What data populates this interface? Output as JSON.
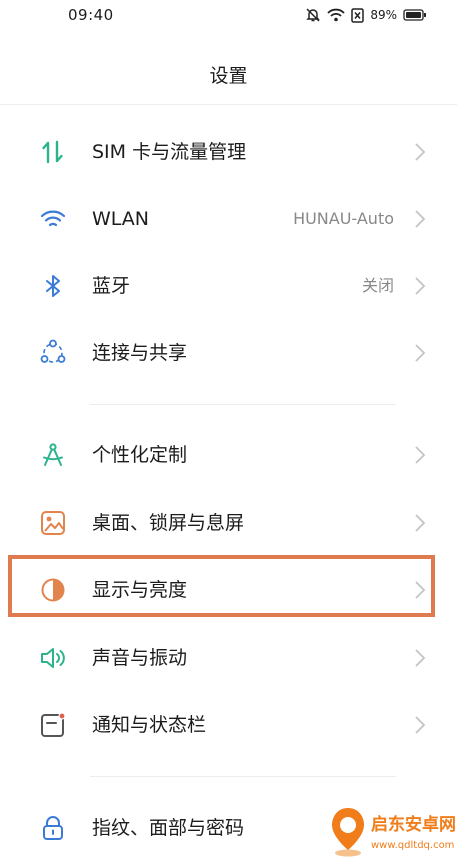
{
  "status_bar": {
    "time": "09:40",
    "battery": "89%"
  },
  "header": {
    "title": "设置"
  },
  "settings": [
    {
      "label": "SIM 卡与流量管理",
      "value": "",
      "icon": "sim-data-icon"
    },
    {
      "label": "WLAN",
      "value": "HUNAU-Auto",
      "icon": "wifi-icon"
    },
    {
      "label": "蓝牙",
      "value": "关闭",
      "icon": "bluetooth-icon"
    },
    {
      "label": "连接与共享",
      "value": "",
      "icon": "share-icon"
    },
    {
      "label": "个性化定制",
      "value": "",
      "icon": "compass-icon"
    },
    {
      "label": "桌面、锁屏与息屏",
      "value": "",
      "icon": "wallpaper-icon"
    },
    {
      "label": "显示与亮度",
      "value": "",
      "icon": "brightness-icon"
    },
    {
      "label": "声音与振动",
      "value": "",
      "icon": "speaker-icon"
    },
    {
      "label": "通知与状态栏",
      "value": "",
      "icon": "notification-icon"
    },
    {
      "label": "指纹、面部与密码",
      "value": "",
      "icon": "lock-icon"
    }
  ],
  "watermark": {
    "title": "启东安卓网",
    "url": "www.qdltdq.com"
  },
  "colors": {
    "accent_teal": "#2bb38c",
    "highlight_box": "#e07a4f",
    "chevron": "#c4c4c4"
  }
}
